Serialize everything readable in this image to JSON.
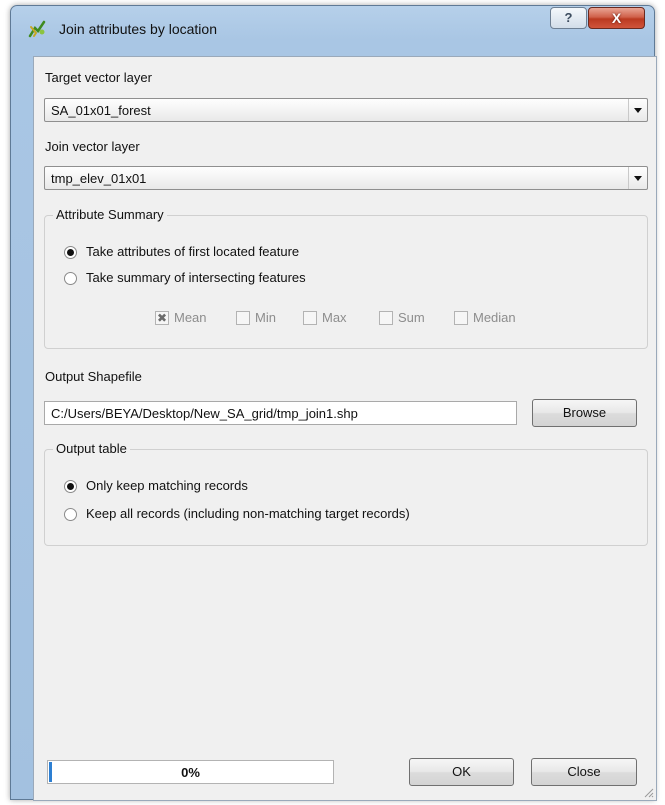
{
  "window": {
    "title": "Join attributes by location",
    "icon": "qgis-tool-icon",
    "help_label": "?",
    "close_label": "X"
  },
  "target_layer": {
    "label": "Target vector layer",
    "value": "SA_01x01_forest"
  },
  "join_layer": {
    "label": "Join vector layer",
    "value": "tmp_elev_01x01"
  },
  "attribute_summary": {
    "title": "Attribute Summary",
    "options": [
      {
        "label": "Take attributes of first located feature",
        "checked": true
      },
      {
        "label": "Take summary of intersecting features",
        "checked": false
      }
    ],
    "statistics": [
      {
        "label": "Mean",
        "checked": true
      },
      {
        "label": "Min",
        "checked": false
      },
      {
        "label": "Max",
        "checked": false
      },
      {
        "label": "Sum",
        "checked": false
      },
      {
        "label": "Median",
        "checked": false
      }
    ]
  },
  "output_shapefile": {
    "label": "Output Shapefile",
    "value": "C:/Users/BEYA/Desktop/New_SA_grid/tmp_join1.shp",
    "browse_label": "Browse"
  },
  "output_table": {
    "title": "Output table",
    "options": [
      {
        "label": "Only keep matching records",
        "checked": true
      },
      {
        "label": "Keep all records (including non-matching target records)",
        "checked": false
      }
    ]
  },
  "progress": {
    "text": "0%",
    "value_percent": 0
  },
  "buttons": {
    "ok_label": "OK",
    "close_label": "Close"
  },
  "colors": {
    "title_bar": "#a9c6e4",
    "close_button": "#c8452b",
    "dialog_background": "#f0f0f0",
    "progress_fill": "#2d7fd2"
  }
}
